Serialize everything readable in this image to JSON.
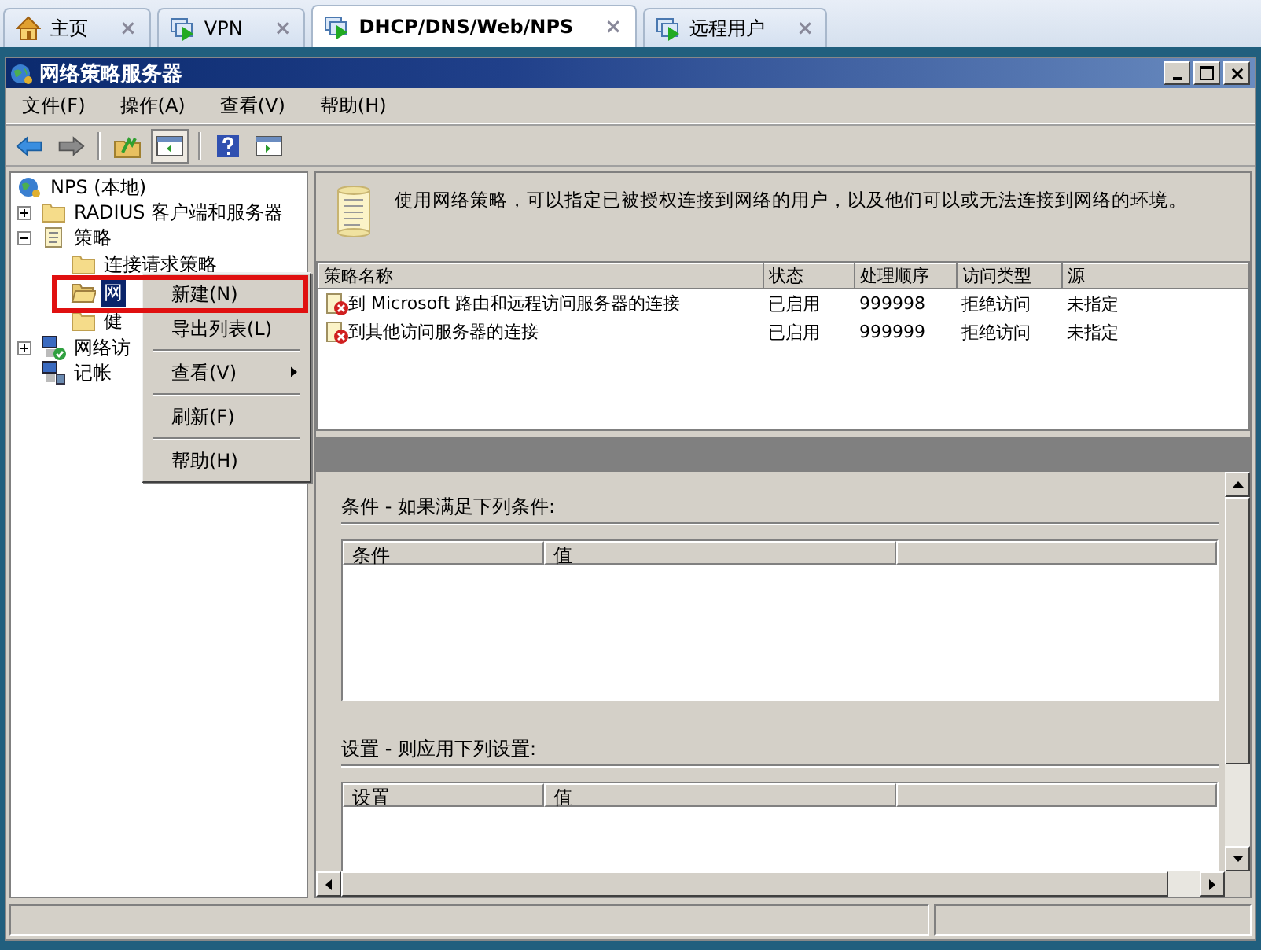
{
  "tabs": [
    {
      "label": "主页",
      "kind": "home",
      "selected": false,
      "close": "×"
    },
    {
      "label": "VPN",
      "kind": "machine",
      "selected": false,
      "close": "×"
    },
    {
      "label": "DHCP/DNS/Web/NPS",
      "kind": "machine",
      "selected": true,
      "close": "×"
    },
    {
      "label": "远程用户",
      "kind": "machine",
      "selected": false,
      "close": "×"
    }
  ],
  "window": {
    "title": "网络策略服务器"
  },
  "menu": [
    "文件(F)",
    "操作(A)",
    "查看(V)",
    "帮助(H)"
  ],
  "tree": [
    {
      "label": "NPS (本地)",
      "kind": "root",
      "selected": false,
      "children": [
        {
          "label": "RADIUS 客户端和服务器",
          "kind": "folder",
          "expanded": false,
          "selected": false
        },
        {
          "label": "策略",
          "kind": "scroll",
          "expanded": true,
          "selected": false,
          "children": [
            {
              "label": "连接请求策略",
              "kind": "folder",
              "selected": false
            },
            {
              "label": "网",
              "kind": "folder",
              "selected": true
            },
            {
              "label": "健",
              "kind": "folder",
              "selected": false
            }
          ]
        },
        {
          "label": "网络访",
          "kind": "network",
          "expanded": false,
          "selected": false
        },
        {
          "label": "记帐",
          "kind": "computer",
          "selected": false
        }
      ]
    }
  ],
  "context_menu": [
    {
      "kind": "item",
      "label": "新建(N)",
      "framed": true
    },
    {
      "kind": "item",
      "label": "导出列表(L)",
      "framed": false
    },
    {
      "kind": "separator"
    },
    {
      "kind": "submenu",
      "label": "查看(V)",
      "framed": false
    },
    {
      "kind": "separator"
    },
    {
      "kind": "item",
      "label": "刷新(F)",
      "framed": false
    },
    {
      "kind": "separator"
    },
    {
      "kind": "item",
      "label": "帮助(H)",
      "framed": false
    }
  ],
  "description": "使用网络策略，可以指定已被授权连接到网络的用户，以及他们可以或无法连接到网络的环境。",
  "policy_table": {
    "columns": [
      "策略名称",
      "状态",
      "处理顺序",
      "访问类型",
      "源"
    ],
    "rows": [
      [
        "到 Microsoft 路由和远程访问服务器的连接",
        "已启用",
        "999998",
        "拒绝访问",
        "未指定"
      ],
      [
        "到其他访问服务器的连接",
        "已启用",
        "999999",
        "拒绝访问",
        "未指定"
      ]
    ]
  },
  "sections": [
    {
      "title": "条件 - 如果满足下列条件:",
      "columns": [
        "条件",
        "值"
      ]
    },
    {
      "title": "设置 - 则应用下列设置:",
      "columns": [
        "设置",
        "值"
      ]
    }
  ]
}
